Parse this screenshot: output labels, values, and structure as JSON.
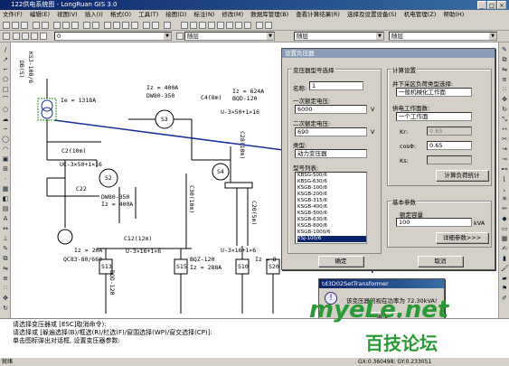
{
  "window": {
    "title": "122供电系统图 - LongRuan GIS 3.0",
    "min": "_",
    "max": "□",
    "close": "×"
  },
  "menu": [
    "文件(F)",
    "编辑(E)",
    "视图(V)",
    "插入(I)",
    "格式(O)",
    "工具(T)",
    "绘图(D)",
    "标注(N)",
    "修改(M)",
    "数据库管理(B)",
    "查看计算结果(R)",
    "选择及设置设备(S)",
    "机电管理(Z)",
    "帮助(H)"
  ],
  "layer_combo": {
    "value": "0"
  },
  "linetype_combo": {
    "value": "随层"
  },
  "color_combo": {
    "value": "随层"
  },
  "linewidth_combo": {
    "value": "随层"
  },
  "diagram": {
    "left_vertical": "KSJ-100/6",
    "left_vertical2": "DB(S)",
    "main_ik": "Ie = 1318A",
    "c2": "C2(10m)",
    "uc_main": "UC-3×50+1×16",
    "s2": "S2",
    "c22": "C22",
    "dw80_left": "DW80-350",
    "iz400_left": "Iz = 400A",
    "iz400_top": "Iz = 400A",
    "dw80_top": "DW80-350",
    "s3": "S3",
    "c4": "C4(8m)",
    "iz624": "Iz = 624A",
    "bqd120_top": "BQD-120",
    "u3_top": "U-3×50+1×16",
    "s4": "S4",
    "c28": "C28(10m)",
    "c30": "C30(10m)",
    "c20": "C20(5m)",
    "c12": "C12(12m)",
    "iz20": "Iz = 20A",
    "qc83": "QC83-80/660",
    "s13": "S13",
    "u3b": "U-3×16+1×6",
    "bqz": "BQZ-120",
    "iz288": "Iz = 288A",
    "s15": "S15",
    "s10": "S10",
    "s20": "S20",
    "bqd120_b": "BQD-120",
    "u3c": "U-3×16+1×6",
    "iz1_c": "Iz = 8"
  },
  "dialog": {
    "title": "设置负压器",
    "group_transformer": "变压器型号选择",
    "name_label": "名称:",
    "name_value": "1",
    "primary_label": "一次额定电压:",
    "primary_value": "6000",
    "primary_unit": "V",
    "secondary_label": "二次额定电压:",
    "secondary_value": "690",
    "secondary_unit": "V",
    "type_label": "类型:",
    "type_value": "动力变压器",
    "model_label": "型号列表:",
    "models": [
      "KBSG-500/6",
      "KBSG-630/6",
      "KSGB-100/6",
      "KSGB-200/6",
      "KSGB-315/6",
      "KSGB-400/6",
      "KSGB-500/6",
      "KSGB-630/6",
      "KSGB-800/6",
      "KSGB-1000/6",
      "KSJ-100/6"
    ],
    "selected_model": "KSJ-100/6",
    "ok": "确定",
    "cancel": "取消",
    "group_calc": "计算设置",
    "well_label": "井下采区负荷类型选择:",
    "well_value": "一般机械化工作面",
    "supply_label": "供电工作面数:",
    "supply_value": "一个工作面",
    "kr_label": "Kr:",
    "kr_value": "0.65",
    "cos_label": "cosΦ:",
    "cos_value": "0.65",
    "ks_label": "Ks:",
    "ks_value": "",
    "calc_button": "计算负荷统计",
    "group_basic": "基本参数",
    "capacity_label": "额定容量",
    "capacity_value": "100",
    "capacity_unit": "kVA",
    "detail_button": "详细参数>>>"
  },
  "msgbox": {
    "title": "td3D02SetTransformer",
    "text": "该变压器的视在功率为 72.30kVA!",
    "ok": "确定"
  },
  "command": {
    "line1": "请选择变压器或 [ESC]取消命令):",
    "line2": "请选择或 [躲遍选择(B)/框选(R)/栏选(F)/窗围选择(WP)/窗交选择(CP)]:",
    "line3": "单击图标弹出对话框, 设置变压器参数:"
  },
  "status": {
    "left": "就绪",
    "coords": "GX:0.360498; GY:0.233051"
  },
  "watermark": {
    "site": "myeLe.net",
    "cn": "百技论坛"
  }
}
